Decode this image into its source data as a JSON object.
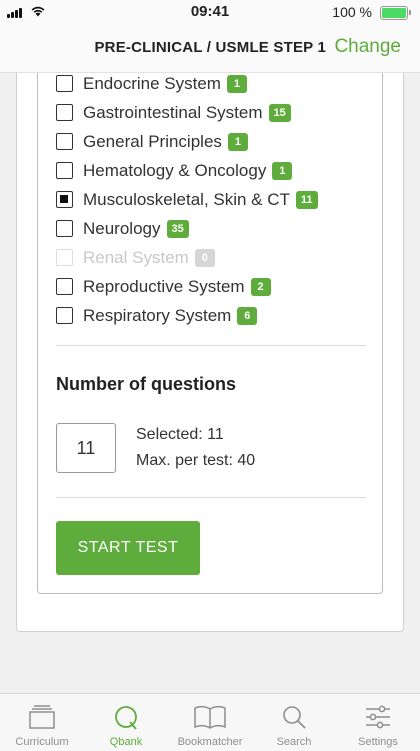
{
  "status_bar": {
    "time": "09:41",
    "battery": "100 %"
  },
  "header": {
    "title": "PRE-CLINICAL / USMLE STEP 1",
    "change_label": "Change"
  },
  "systems": [
    {
      "label": "Endocrine System",
      "count": "1",
      "checked": false,
      "disabled": false
    },
    {
      "label": "Gastrointestinal System",
      "count": "15",
      "checked": false,
      "disabled": false
    },
    {
      "label": "General Principles",
      "count": "1",
      "checked": false,
      "disabled": false
    },
    {
      "label": "Hematology & Oncology",
      "count": "1",
      "checked": false,
      "disabled": false
    },
    {
      "label": "Musculoskeletal, Skin & CT",
      "count": "11",
      "checked": true,
      "disabled": false
    },
    {
      "label": "Neurology",
      "count": "35",
      "checked": false,
      "disabled": false
    },
    {
      "label": "Renal System",
      "count": "0",
      "checked": false,
      "disabled": true
    },
    {
      "label": "Reproductive System",
      "count": "2",
      "checked": false,
      "disabled": false
    },
    {
      "label": "Respiratory System",
      "count": "6",
      "checked": false,
      "disabled": false
    }
  ],
  "questions": {
    "title": "Number of questions",
    "value": "11",
    "selected_text": "Selected: 11",
    "max_text": "Max. per test: 40"
  },
  "start_button_label": "START TEST",
  "tabs": [
    {
      "label": "Curriculum",
      "icon": "curriculum-icon",
      "active": false
    },
    {
      "label": "Qbank",
      "icon": "qbank-icon",
      "active": true
    },
    {
      "label": "Bookmatcher",
      "icon": "book-icon",
      "active": false
    },
    {
      "label": "Search",
      "icon": "search-icon",
      "active": false
    },
    {
      "label": "Settings",
      "icon": "settings-icon",
      "active": false
    }
  ],
  "colors": {
    "accent": "#5eac3b",
    "disabled": "#d6d6d6"
  }
}
